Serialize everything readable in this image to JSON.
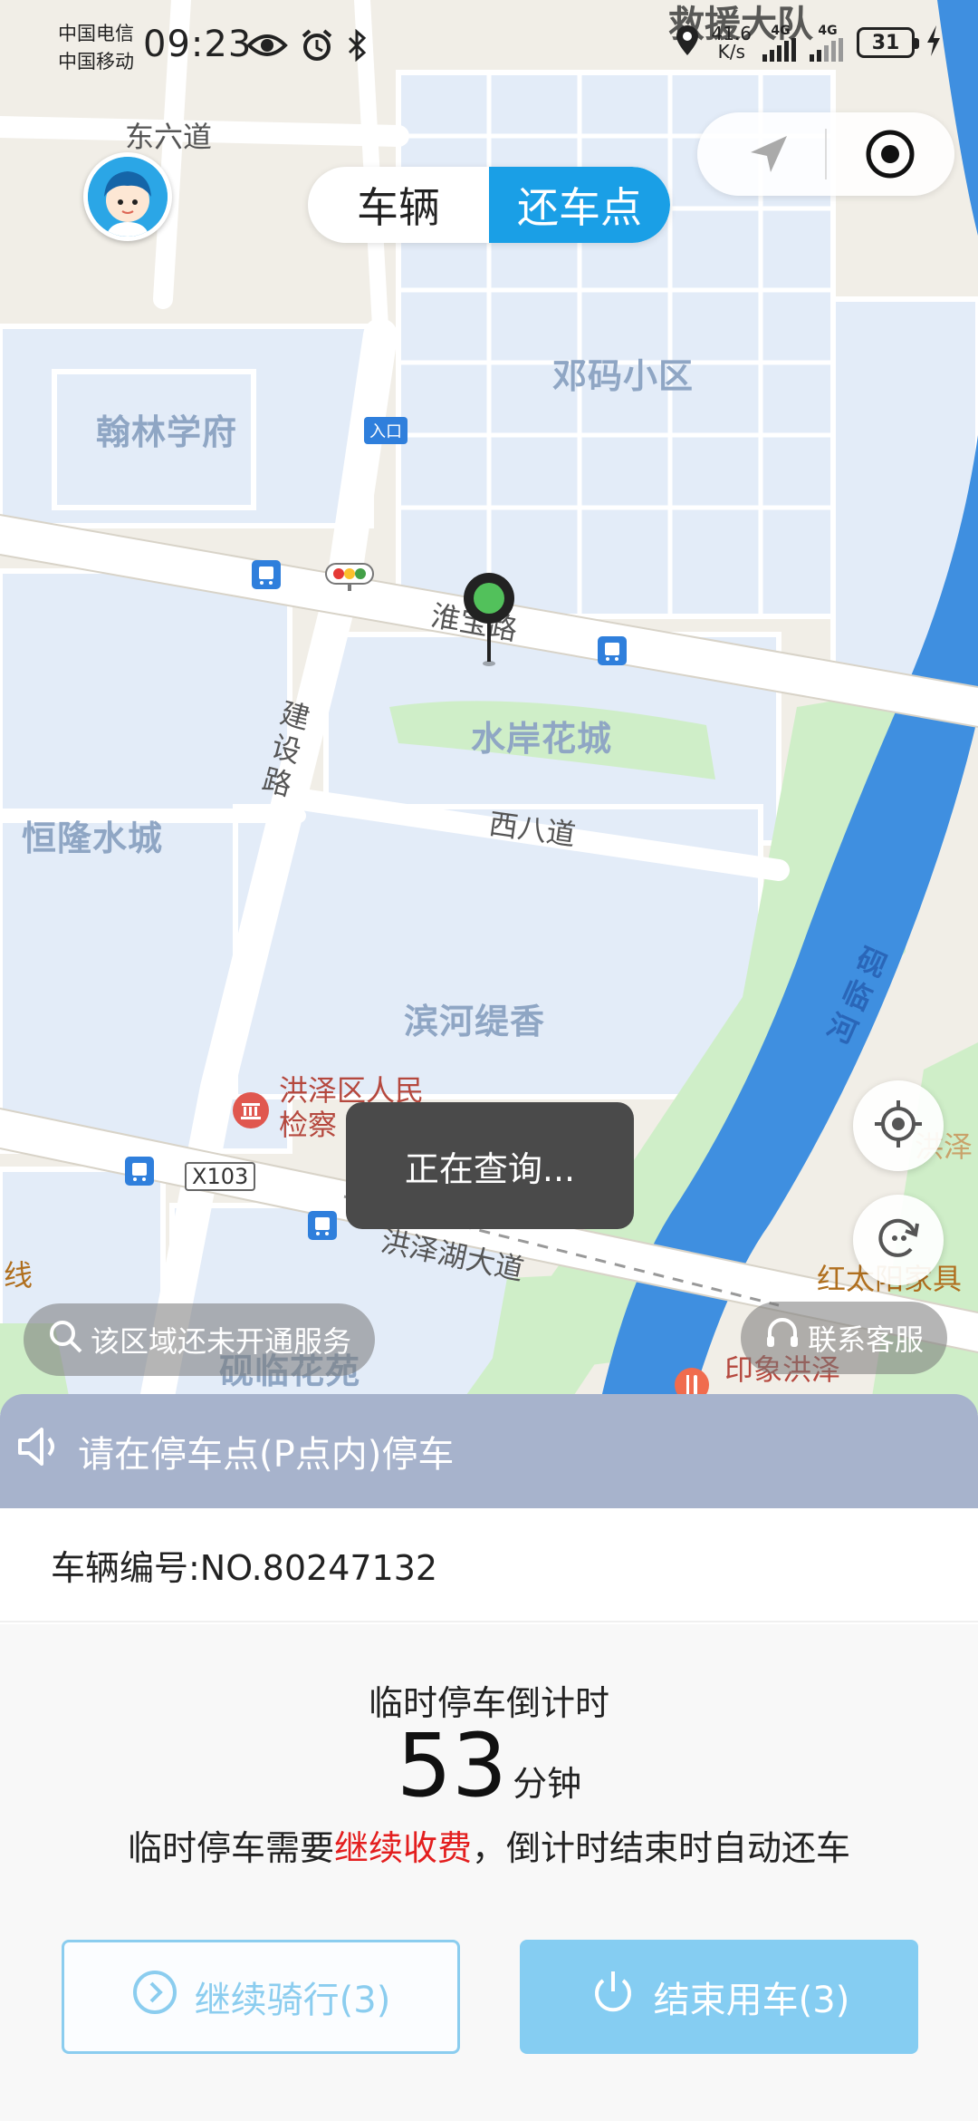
{
  "status_bar": {
    "carrier_1": "中国电信",
    "carrier_2": "中国移动",
    "time": "09:23",
    "speed_value": "41.6",
    "speed_unit": "K/s",
    "net_1": "4G",
    "net_2": "4G",
    "battery": "31",
    "overlay_text": "救援大队"
  },
  "map": {
    "labels": {
      "dongliudao": "东六道",
      "denma": "邓码小区",
      "hanlin": "翰林学府",
      "huaiyu": "淮宝路",
      "shuian": "水岸花城",
      "jianshe": "建设路",
      "xibadao": "西八道",
      "henglong": "恒隆水城",
      "binhe": "滨河缇香",
      "yanlinhe": "砚临河",
      "poi_court": "洪泽区人民检察",
      "x103": "X103",
      "hongzehu": "洪泽湖大道",
      "yanlin_garden": "砚临花苑",
      "hongtaiyang": "红太阳家具",
      "yinxiang": "印象洪泽",
      "xian": "线",
      "entrance": "入口",
      "hongze_partial": "洪泽"
    }
  },
  "toggle": {
    "vehicle": "车辆",
    "return_point": "还车点"
  },
  "map_controls": {
    "service_area": "该区域还未开通服务",
    "customer_service": "联系客服",
    "toast": "正在查询..."
  },
  "notice": {
    "text": "请在停车点(P点内)停车"
  },
  "vehicle": {
    "number_label": "车辆编号:NO.80247132"
  },
  "countdown": {
    "title": "临时停车倒计时",
    "minutes": "53",
    "unit": "分钟",
    "note_before": "临时停车需要",
    "note_highlight": "继续收费",
    "note_after": "，倒计时结束时自动还车"
  },
  "buttons": {
    "continue": "继续骑行(3)",
    "end": "结束用车(3)"
  },
  "colors": {
    "accent": "#1a9fe6",
    "notice_bg": "#a7b3cc",
    "warning_red": "#e31e1e",
    "button_light": "#85cdf2",
    "river": "#3f8fe0",
    "green_area": "#cfeec8"
  }
}
